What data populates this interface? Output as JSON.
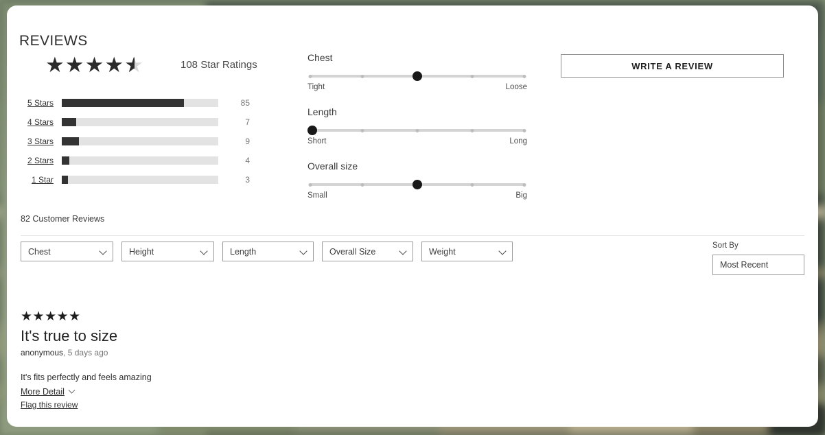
{
  "theme": {
    "accent": "#333333",
    "backdrop_green": "#8a9a7b",
    "card_bg": "#ffffff",
    "track_gray": "#e3e3e3",
    "muted_text": "#767676"
  },
  "section": {
    "title": "REVIEWS"
  },
  "summary": {
    "stars_filled": 4,
    "has_half_star": true,
    "star_glyph": "★",
    "ratings_count_label": "108 Star Ratings",
    "histogram": {
      "max": 108,
      "rows": [
        {
          "label": "5 Stars",
          "value": 85,
          "percent": 78
        },
        {
          "label": "4 Stars",
          "value": 7,
          "percent": 9
        },
        {
          "label": "3 Stars",
          "value": 9,
          "percent": 11
        },
        {
          "label": "2 Stars",
          "value": 4,
          "percent": 5
        },
        {
          "label": "1 Star",
          "value": 3,
          "percent": 4
        }
      ]
    }
  },
  "fit_sliders": {
    "ticks": 5,
    "groups": [
      {
        "name": "Chest",
        "left_label": "Tight",
        "right_label": "Loose",
        "value": 3,
        "percent": 50
      },
      {
        "name": "Length",
        "left_label": "Short",
        "right_label": "Long",
        "value": 1,
        "percent": 0
      },
      {
        "name": "Overall size",
        "left_label": "Small",
        "right_label": "Big",
        "value": 3,
        "percent": 50
      }
    ]
  },
  "actions": {
    "write_review_label": "WRITE A REVIEW"
  },
  "list_header": {
    "count_label": "82 Customer Reviews"
  },
  "filters": [
    {
      "label": "Chest",
      "width": 135,
      "icon": "chevron-down-icon"
    },
    {
      "label": "Height",
      "width": 135,
      "icon": "chevron-down-icon"
    },
    {
      "label": "Length",
      "width": 133,
      "icon": "chevron-down-icon"
    },
    {
      "label": "Overall Size",
      "width": 133,
      "icon": "chevron-down-icon"
    },
    {
      "label": "Weight",
      "width": 133,
      "icon": "chevron-down-icon"
    }
  ],
  "sort": {
    "label": "Sort By",
    "selected": "Most Recent"
  },
  "reviews": [
    {
      "stars": 5,
      "stars_glyphs": "★★★★★",
      "title": "It's true to size",
      "author": "anonymous",
      "separator": ",",
      "date": "5 days ago",
      "body": "It's fits perfectly and feels amazing",
      "more_detail_label": "More Detail",
      "more_detail_icon": "chevron-down-icon",
      "flag_label": "Flag this review"
    }
  ]
}
